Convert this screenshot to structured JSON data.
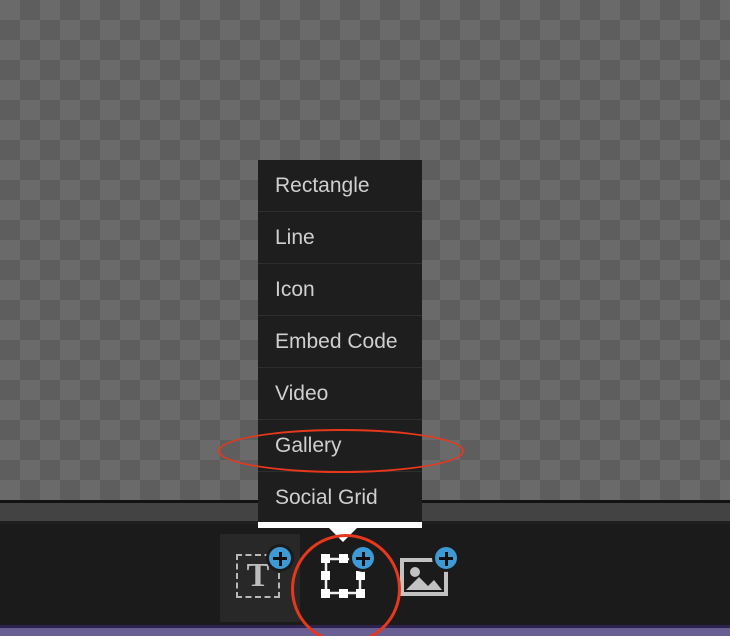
{
  "app": {
    "canvas": {
      "name": "transparent-canvas",
      "checker_color_light": "#6a6a6a",
      "checker_color_dark": "#5e5e5e"
    },
    "colors": {
      "menu_background": "#1e1e1e",
      "menu_text": "#cfcfcf",
      "toolbar_background": "#1b1b1b",
      "annotation_red": "#e8381b",
      "badge_blue": "#3d9ad4",
      "footer_purple": "#6a5f92",
      "gray_band": "#434343"
    }
  },
  "menu": {
    "name": "add-element-menu",
    "items": [
      {
        "label": "Rectangle"
      },
      {
        "label": "Line"
      },
      {
        "label": "Icon"
      },
      {
        "label": "Embed Code"
      },
      {
        "label": "Video"
      },
      {
        "label": "Gallery"
      },
      {
        "label": "Social Grid"
      }
    ],
    "highlighted_item": "Gallery"
  },
  "toolbar": {
    "name": "add-element-toolbar",
    "buttons": [
      {
        "icon": "add-text-icon",
        "label": "T",
        "badge": "plus-badge"
      },
      {
        "icon": "add-shape-icon",
        "label": "",
        "badge": "plus-badge"
      },
      {
        "icon": "add-image-icon",
        "label": "",
        "badge": "plus-badge"
      }
    ],
    "active_button": "add-shape-icon"
  },
  "annotations": [
    {
      "name": "gallery-highlight-ellipse",
      "shape": "ellipse",
      "target": "Gallery"
    },
    {
      "name": "shape-tool-highlight-circle",
      "shape": "circle",
      "target": "add-shape-icon"
    }
  ]
}
